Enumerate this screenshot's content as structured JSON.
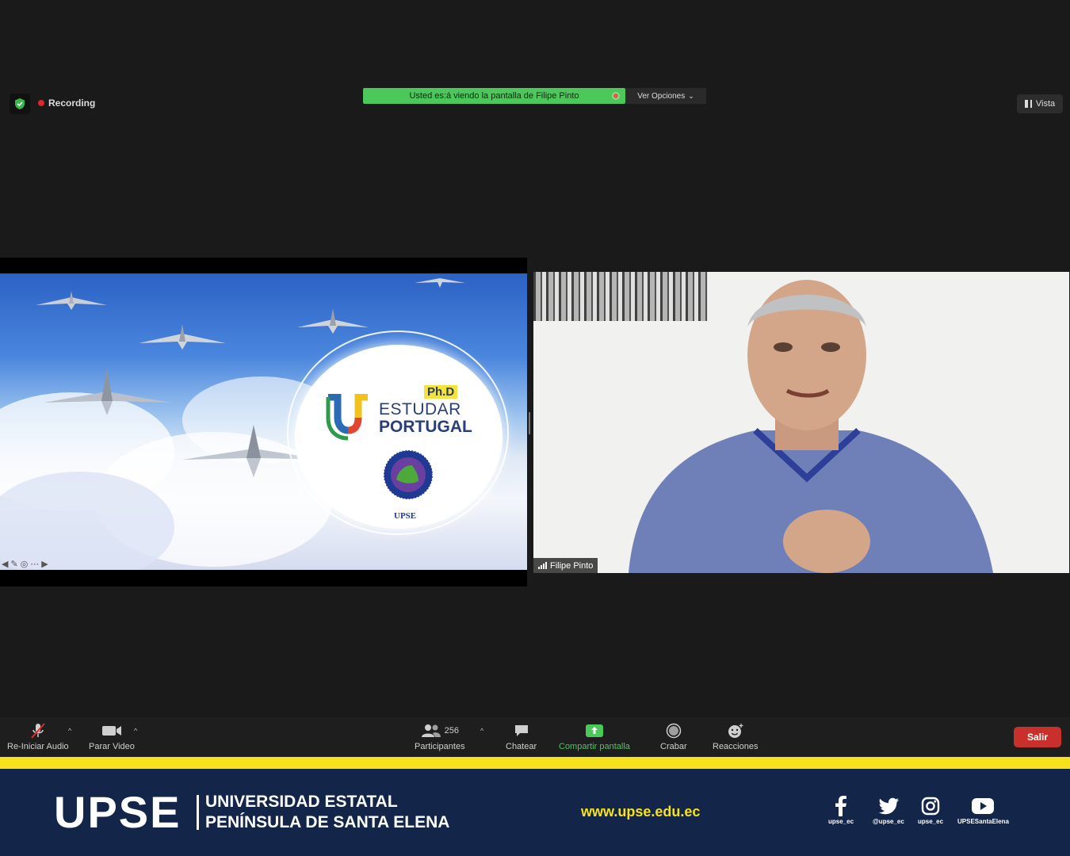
{
  "top_bar": {
    "recording_label": "Recording",
    "share_banner_text": "Usted es:á viendo la pantalla de Filipe Pinto",
    "view_options_label": "Ver Opciones",
    "view_label": "Vista"
  },
  "slide": {
    "phd_label": "Ph.D",
    "estudar_label": "ESTUDAR",
    "portugal_label": "PORTUGAL",
    "seal_label": "UPSE"
  },
  "video": {
    "participant_name": "Filipe Pinto"
  },
  "toolbar": {
    "audio_label": "Re-Iniciar Audio",
    "video_label": "Parar Video",
    "participants_count": "256",
    "participants_label": "Participantes",
    "chat_label": "Chatear",
    "share_label": "Compartir pantalla",
    "record_label": "Crabar",
    "reactions_label": "Reacciones",
    "leave_label": "Salir",
    "share_accent": "#4cc85a",
    "leave_color": "#c8312b"
  },
  "footer": {
    "brand": "UPSE",
    "university_line1": "UNIVERSIDAD ESTATAL",
    "university_line2": "PENÍNSULA DE SANTA ELENA",
    "website": "www.upse.edu.ec",
    "social": [
      {
        "icon": "facebook-icon",
        "handle": "upse_ec"
      },
      {
        "icon": "twitter-icon",
        "handle": "@upse_ec"
      },
      {
        "icon": "instagram-icon",
        "handle": "upse_ec"
      },
      {
        "icon": "youtube-icon",
        "handle": "UPSESantaElena"
      }
    ],
    "accent_yellow": "#f6e21c",
    "background_navy": "#13264a"
  }
}
